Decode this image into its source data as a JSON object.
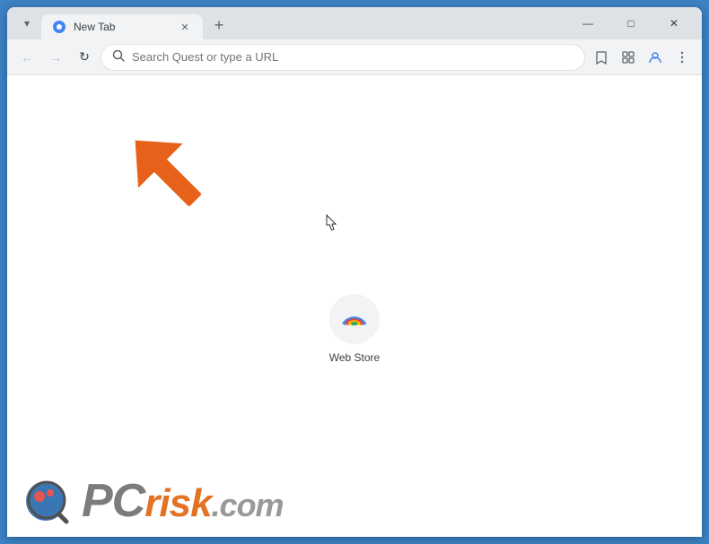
{
  "browser": {
    "tab": {
      "title": "New Tab",
      "favicon": "circle-icon"
    },
    "new_tab_button": "+",
    "window_controls": {
      "minimize": "—",
      "maximize": "□",
      "close": "✕"
    },
    "address_bar": {
      "placeholder": "Search Quest or type a URL",
      "value": ""
    },
    "nav": {
      "back": "←",
      "forward": "→",
      "reload": "↻"
    }
  },
  "shortcuts": [
    {
      "label": "Web Store",
      "icon": "webstore-icon"
    }
  ],
  "watermark": {
    "brand": "PCrisk.com"
  },
  "arrow": {
    "direction": "up-right"
  }
}
